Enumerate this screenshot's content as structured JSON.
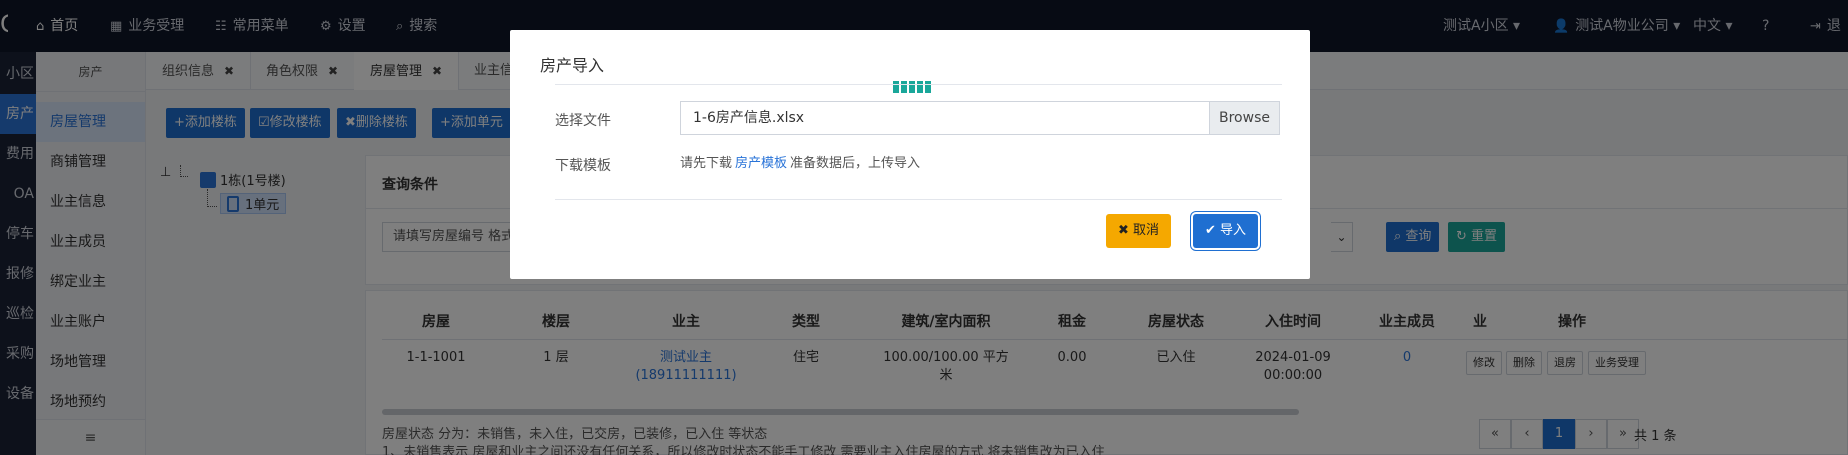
{
  "nav": {
    "logo": "C",
    "items": [
      {
        "icon": "home-icon",
        "glyph": "⌂",
        "label": "首页"
      },
      {
        "icon": "calculator-icon",
        "glyph": "▦",
        "label": "业务受理"
      },
      {
        "icon": "sitemap-icon",
        "glyph": "☷",
        "label": "常用菜单"
      },
      {
        "icon": "gear-icon",
        "glyph": "⚙",
        "label": "设置"
      },
      {
        "icon": "search-icon",
        "glyph": "⌕",
        "label": "搜索"
      }
    ],
    "community": "测试A小区",
    "company": "测试A物业公司",
    "language": "中文",
    "help_glyph": "?",
    "logout": "退"
  },
  "rail": [
    {
      "label": "小区",
      "active": false
    },
    {
      "label": "房产",
      "active": true
    },
    {
      "label": "费用",
      "active": false
    },
    {
      "label": "OA",
      "active": false
    },
    {
      "label": "停车",
      "active": false
    },
    {
      "label": "报修",
      "active": false
    },
    {
      "label": "巡检",
      "active": false
    },
    {
      "label": "采购",
      "active": false
    },
    {
      "label": "设备",
      "active": false
    }
  ],
  "sidebar": {
    "heading": "房产",
    "items": [
      {
        "label": "房屋管理",
        "active": true
      },
      {
        "label": "商铺管理",
        "active": false
      },
      {
        "label": "业主信息",
        "active": false
      },
      {
        "label": "业主成员",
        "active": false
      },
      {
        "label": "绑定业主",
        "active": false
      },
      {
        "label": "业主账户",
        "active": false
      },
      {
        "label": "场地管理",
        "active": false
      },
      {
        "label": "场地预约",
        "active": false
      }
    ],
    "collapse_glyph": "≡"
  },
  "tabs": [
    {
      "label": "组织信息",
      "active": false
    },
    {
      "label": "角色权限",
      "active": false
    },
    {
      "label": "房屋管理",
      "active": true
    },
    {
      "label": "业主信",
      "active": false
    }
  ],
  "toolbar": {
    "add_building": "+添加楼栋",
    "edit_building": "☑修改楼栋",
    "delete_building": "✖删除楼栋",
    "add_unit": "+添加单元"
  },
  "tree": {
    "building": "1栋(1号楼)",
    "unit": "1单元"
  },
  "query": {
    "title": "查询条件",
    "placeholder": "请填写房屋编号  格式",
    "select_arrow": "⌄",
    "search": "⌕ 查询",
    "reset": "↻ 重置"
  },
  "table": {
    "headers": [
      "房屋",
      "楼层",
      "业主",
      "类型",
      "建筑/室内面积",
      "租金",
      "房屋状态",
      "入住时间",
      "业主成员",
      "业",
      "操作"
    ],
    "row": {
      "room": "1-1-1001",
      "floor": "1 层",
      "owner_name": "测试业主",
      "owner_phone": "(18911111111)",
      "type": "住宅",
      "area_line1": "100.00/100.00 平方",
      "area_line2": "米",
      "rent": "0.00",
      "status": "已入住",
      "checkin_date": "2024-01-09",
      "checkin_time": "00:00:00",
      "members": "0"
    },
    "actions": [
      "修改",
      "删除",
      "退房",
      "业务受理"
    ],
    "note1": "房屋状态 分为：未销售，未入住，已交房，已装修，已入住 等状态",
    "note2": "1、未销售表示 房屋和业主之间还没有任何关系，所以修改时状态不能手工修改 需要业主入住房屋的方式 将未销售改为已入住",
    "pager": [
      "«",
      "‹",
      "1",
      "›",
      "»"
    ],
    "total": "共 1 条"
  },
  "modal": {
    "title": "房产导入",
    "file_label": "选择文件",
    "file_name": "1-6房产信息.xlsx",
    "browse": "Browse",
    "template_label": "下载模板",
    "tip_before": "请先下载",
    "tip_link": "房产模板",
    "tip_after": "准备数据后，上传导入",
    "cancel": "✖ 取消",
    "import": "✔ 导入",
    "progress_segments": 5
  },
  "colors": {
    "primary": "#1f6fd1",
    "nav_bg": "#0f1629",
    "warning": "#f5a800",
    "teal": "#1aa79a"
  }
}
